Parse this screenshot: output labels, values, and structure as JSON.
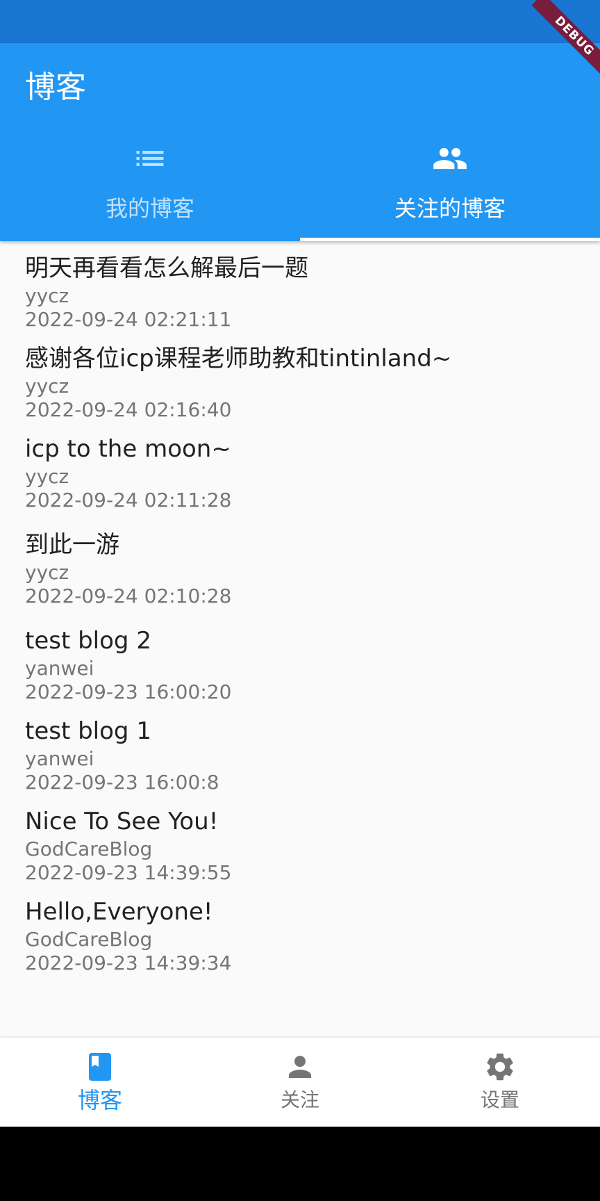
{
  "colors": {
    "primary": "#2196f3",
    "status_bar": "#1976d2",
    "text_primary": "#212121",
    "text_secondary": "#757575",
    "background": "#fafafa",
    "debug_banner": "#7a1c3b"
  },
  "app_bar": {
    "title": "博客"
  },
  "tabs": [
    {
      "label": "我的博客",
      "icon": "list-icon",
      "active": false
    },
    {
      "label": "关注的博客",
      "icon": "group-icon",
      "active": true
    }
  ],
  "blogs": [
    {
      "title": "明天再看看怎么解最后一题",
      "author": "yycz",
      "time": "2022-09-24 02:21:11"
    },
    {
      "title": "感谢各位icp课程老师助教和tintinland~",
      "author": "yycz",
      "time": "2022-09-24 02:16:40"
    },
    {
      "title": "icp to the moon~",
      "author": "yycz",
      "time": "2022-09-24 02:11:28"
    },
    {
      "title": "到此一游",
      "author": "yycz",
      "time": "2022-09-24 02:10:28"
    },
    {
      "title": "test blog 2",
      "author": "yanwei",
      "time": "2022-09-23 16:00:20"
    },
    {
      "title": "test blog 1",
      "author": "yanwei",
      "time": "2022-09-23 16:00:8"
    },
    {
      "title": "Nice To See You!",
      "author": "GodCareBlog",
      "time": "2022-09-23 14:39:55"
    },
    {
      "title": "Hello,Everyone!",
      "author": "GodCareBlog",
      "time": "2022-09-23 14:39:34"
    }
  ],
  "bottom_nav": [
    {
      "label": "博客",
      "icon": "book-icon",
      "active": true
    },
    {
      "label": "关注",
      "icon": "person-icon",
      "active": false
    },
    {
      "label": "设置",
      "icon": "gear-icon",
      "active": false
    }
  ],
  "debug_banner": {
    "label": "DEBUG"
  }
}
